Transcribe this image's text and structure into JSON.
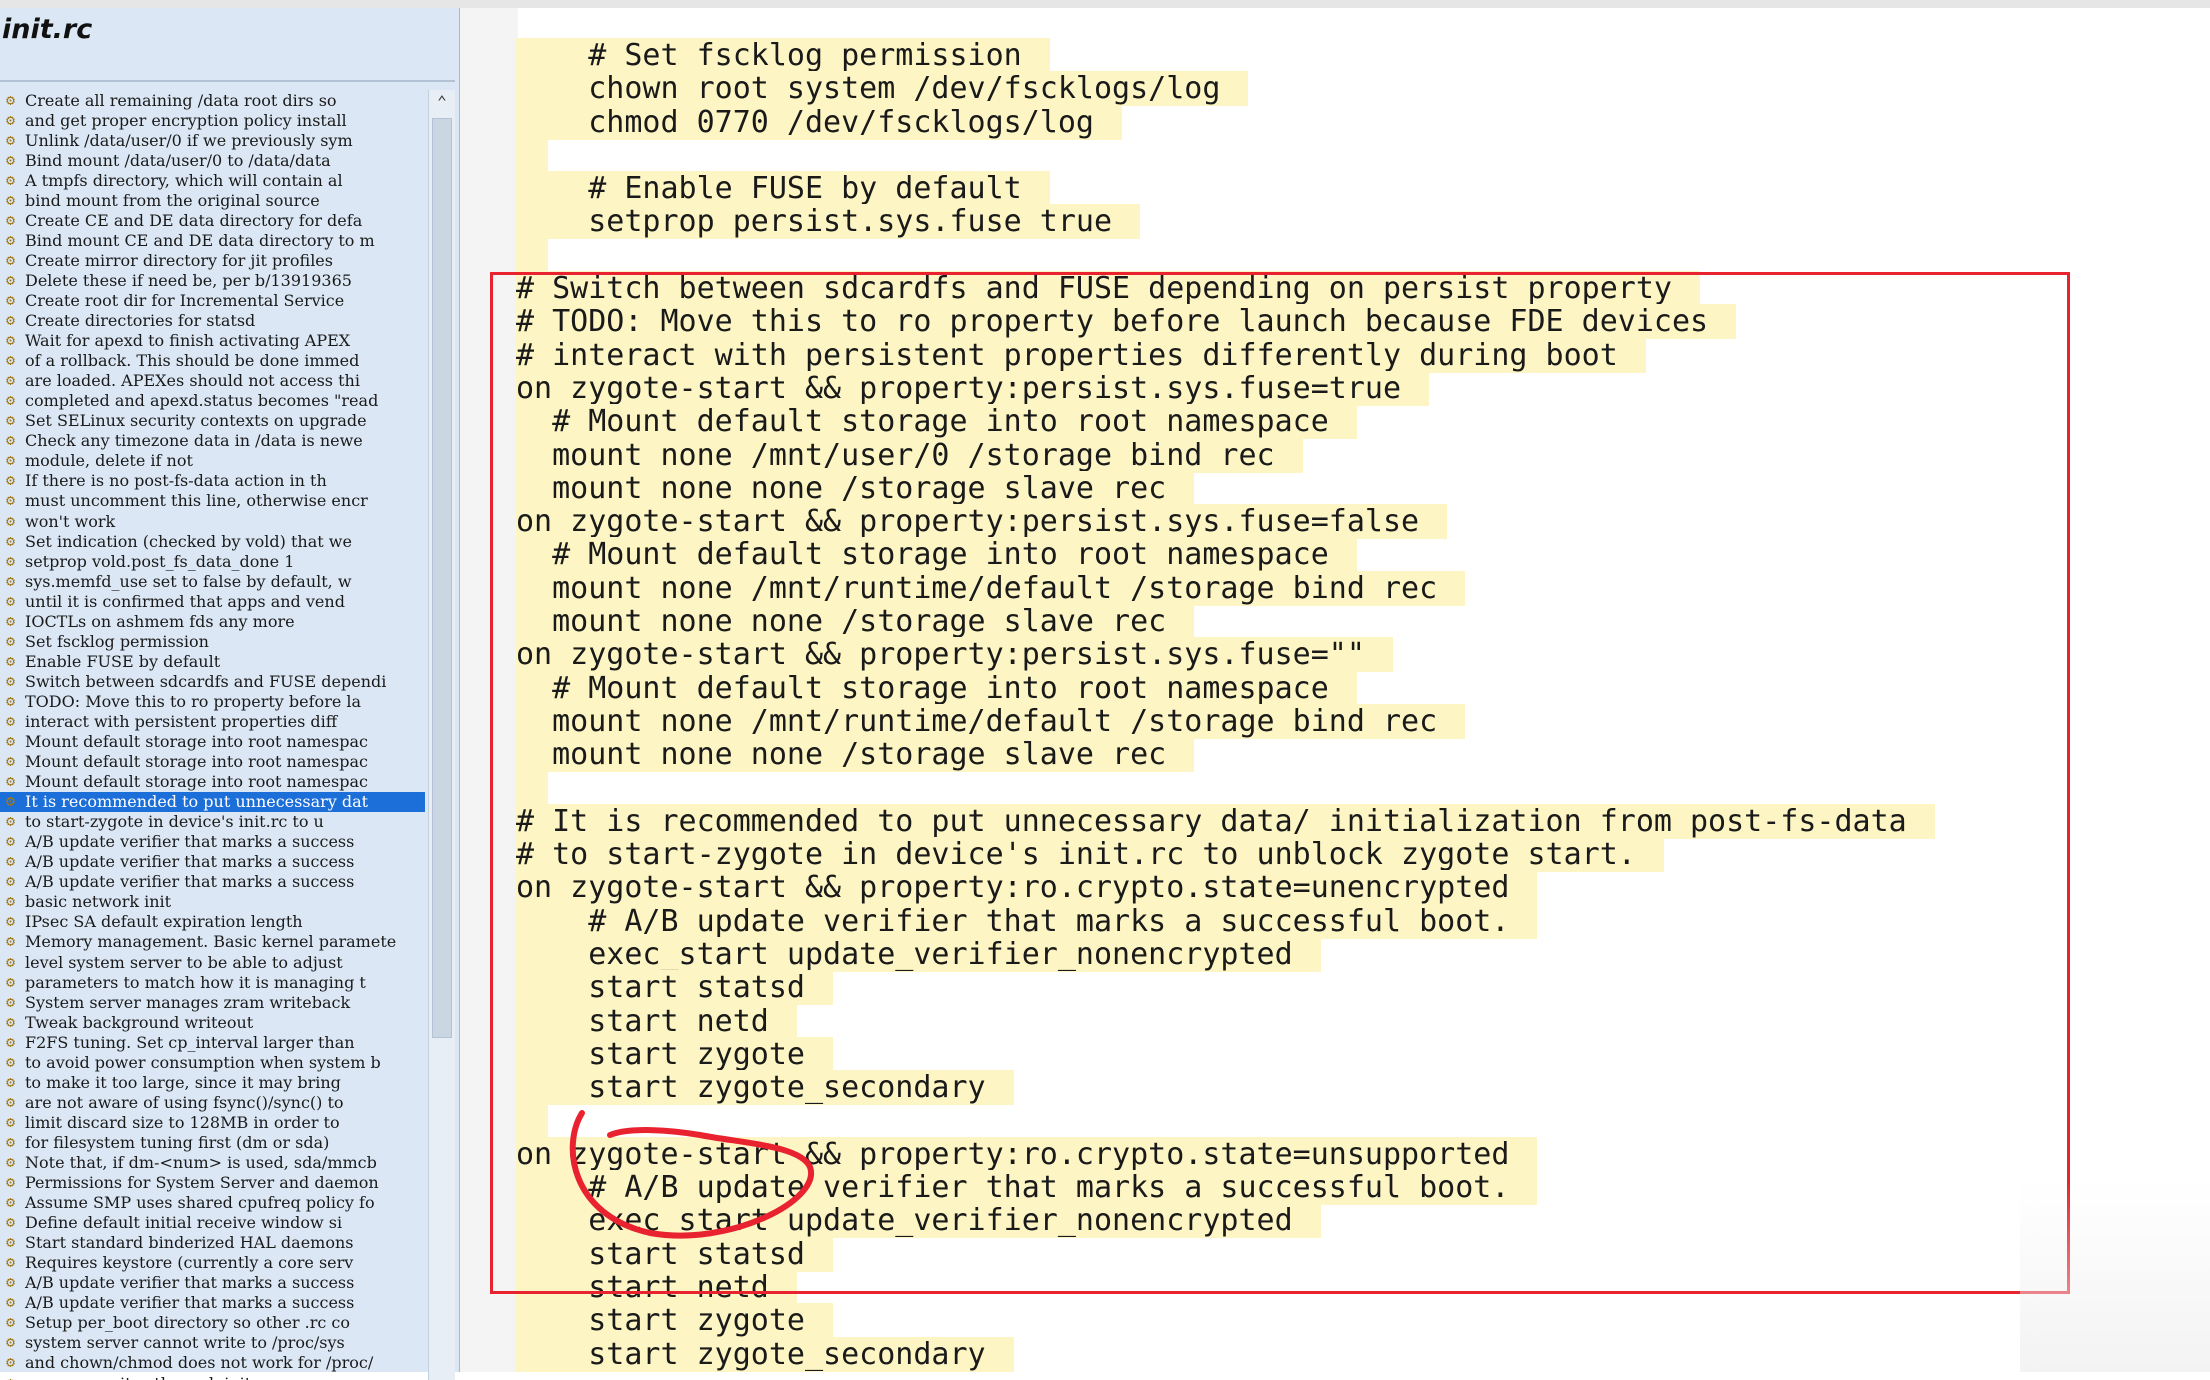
{
  "file": {
    "title": "init.rc"
  },
  "outline": {
    "selected_index": 35,
    "items": [
      "Create all remaining /data root dirs so",
      "and get proper encryption policy install",
      "Unlink /data/user/0 if we previously sym",
      "Bind mount /data/user/0 to /data/data",
      "A tmpfs directory, which will contain al",
      "bind mount from the original source",
      "Create CE and DE data directory for defa",
      "Bind mount CE and DE data directory to m",
      "Create mirror directory for jit profiles",
      "Delete these if need be, per b/13919365",
      "Create root dir for Incremental Service",
      "Create directories for statsd",
      "Wait for apexd to finish activating APEX",
      "of a rollback. This should be done immed",
      "are loaded. APEXes should not access thi",
      "completed and apexd.status becomes \"read",
      "Set SELinux security contexts on upgrade",
      "Check any timezone data in /data is newe",
      "module, delete if not",
      "If there is no post-fs-data action in th",
      "must uncomment this line, otherwise encr",
      "won't work",
      "Set indication (checked by vold) that we",
      "setprop vold.post_fs_data_done 1",
      "sys.memfd_use set to false by default, w",
      "until it is confirmed that apps and vend",
      "IOCTLs on ashmem fds any more",
      "Set fscklog permission",
      "Enable FUSE by default",
      "Switch between sdcardfs and FUSE dependi",
      "TODO: Move this to ro property before la",
      "interact with persistent properties diff",
      "Mount default storage into root namespac",
      "Mount default storage into root namespac",
      "Mount default storage into root namespac",
      "It is recommended to put unnecessary dat",
      "to start-zygote in device's init.rc to u",
      "A/B update verifier that marks a success",
      "A/B update verifier that marks a success",
      "A/B update verifier that marks a success",
      "basic network init",
      "IPsec SA default expiration length",
      "Memory management. Basic kernel paramete",
      "level system server to be able to adjust",
      "parameters to match how it is managing t",
      "System server manages zram writeback",
      "Tweak background writeout",
      "F2FS tuning. Set cp_interval larger than",
      "to avoid power consumption when system b",
      "to make it too large, since it may bring",
      "are not aware of using fsync()/sync() to",
      "limit discard size to 128MB in order to",
      "for filesystem tuning first (dm or sda)",
      "Note that, if dm-<num> is used, sda/mmcb",
      "Permissions for System Server and daemon",
      "Assume SMP uses shared cpufreq policy fo",
      "Define default initial receive window si",
      "Start standard binderized HAL daemons",
      "Requires keystore (currently a core serv",
      "A/B update verifier that marks a success",
      "A/B update verifier that marks a success",
      "Setup per_boot directory so other .rc co",
      "system server cannot write to /proc/sys",
      "and chown/chmod does not work for /proc/",
      "so proxy writes through init"
    ]
  },
  "code_lines": [
    "    # Set fscklog permission",
    "    chown root system /dev/fscklogs/log",
    "    chmod 0770 /dev/fscklogs/log",
    "",
    "    # Enable FUSE by default",
    "    setprop persist.sys.fuse true",
    "",
    "# Switch between sdcardfs and FUSE depending on persist property",
    "# TODO: Move this to ro property before launch because FDE devices",
    "# interact with persistent properties differently during boot",
    "on zygote-start && property:persist.sys.fuse=true",
    "  # Mount default storage into root namespace",
    "  mount none /mnt/user/0 /storage bind rec",
    "  mount none none /storage slave rec",
    "on zygote-start && property:persist.sys.fuse=false",
    "  # Mount default storage into root namespace",
    "  mount none /mnt/runtime/default /storage bind rec",
    "  mount none none /storage slave rec",
    "on zygote-start && property:persist.sys.fuse=\"\"",
    "  # Mount default storage into root namespace",
    "  mount none /mnt/runtime/default /storage bind rec",
    "  mount none none /storage slave rec",
    "",
    "# It is recommended to put unnecessary data/ initialization from post-fs-data",
    "# to start-zygote in device's init.rc to unblock zygote start.",
    "on zygote-start && property:ro.crypto.state=unencrypted",
    "    # A/B update verifier that marks a successful boot.",
    "    exec_start update_verifier_nonencrypted",
    "    start statsd",
    "    start netd",
    "    start zygote",
    "    start zygote_secondary",
    "",
    "on zygote-start && property:ro.crypto.state=unsupported",
    "    # A/B update verifier that marks a successful boot.",
    "    exec_start update_verifier_nonencrypted",
    "    start statsd",
    "    start netd",
    "    start zygote",
    "    start zygote_secondary"
  ],
  "colors": {
    "highlight": "#fdf6c4",
    "annotation_box": "#e8232f",
    "selection": "#1c6fd8"
  },
  "icons": {
    "outline_item": "gear-icon",
    "scroll_up": "chevron-up-icon"
  }
}
